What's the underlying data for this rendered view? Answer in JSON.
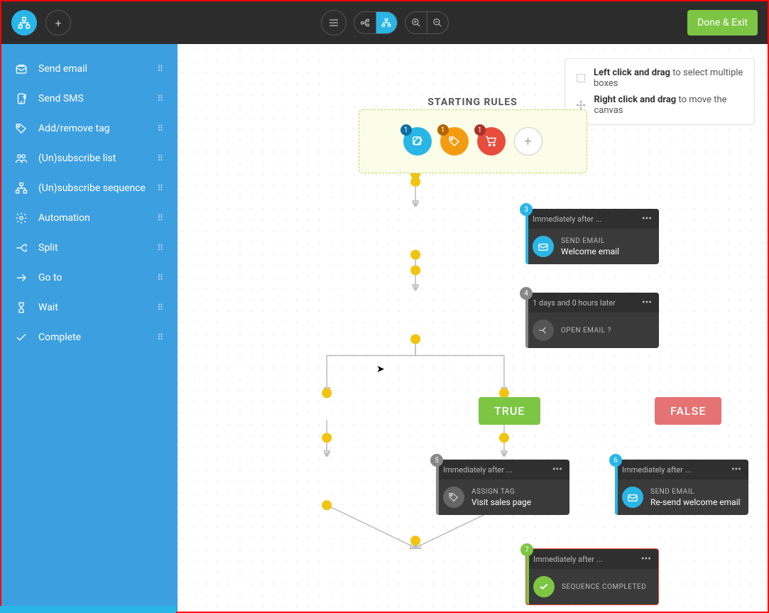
{
  "topbar": {
    "done_label": "Done & Exit"
  },
  "sidebar": {
    "items": [
      {
        "label": "Send email"
      },
      {
        "label": "Send SMS"
      },
      {
        "label": "Add/remove tag"
      },
      {
        "label": "(Un)subscribe list"
      },
      {
        "label": "(Un)subscribe sequence"
      },
      {
        "label": "Automation"
      },
      {
        "label": "Split"
      },
      {
        "label": "Go to"
      },
      {
        "label": "Wait"
      },
      {
        "label": "Complete"
      }
    ]
  },
  "help": {
    "left_bold": "Left click and drag",
    "left_rest": " to select multiple boxes",
    "right_bold": "Right click and drag",
    "right_rest": " to move the canvas"
  },
  "canvas": {
    "starting_rules_label": "STARTING RULES",
    "rules": [
      {
        "badge": "1"
      },
      {
        "badge": "1"
      },
      {
        "badge": "1"
      }
    ],
    "nodes": {
      "n3": {
        "num": "3",
        "hdr": "Immediately after ...",
        "t1": "SEND EMAIL",
        "t2": "Welcome email"
      },
      "n4": {
        "num": "4",
        "hdr": "1 days and 0 hours later",
        "t1": "OPEN EMAIL ?",
        "t2": ""
      },
      "n5": {
        "num": "5",
        "hdr": "Immediately after ...",
        "t1": "ASSIGN TAG",
        "t2": "Visit sales page"
      },
      "n6": {
        "num": "6",
        "hdr": "Immediately after ...",
        "t1": "SEND EMAIL",
        "t2": "Re-send welcome email"
      },
      "n7": {
        "num": "7",
        "hdr": "Immediately after ...",
        "t1": "SEQUENCE COMPLETED",
        "t2": ""
      }
    },
    "branch": {
      "true_label": "TRUE",
      "false_label": "FALSE"
    }
  }
}
